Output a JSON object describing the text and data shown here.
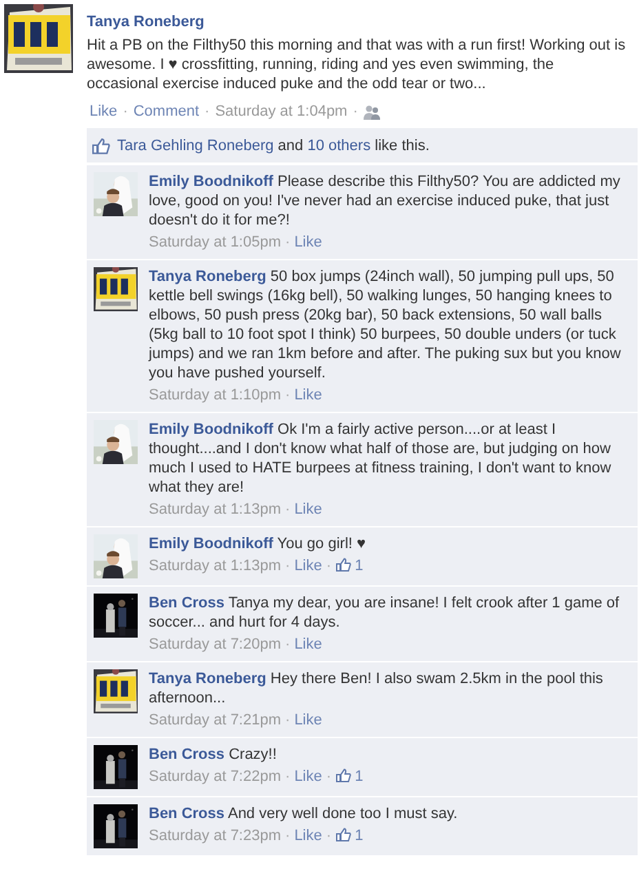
{
  "post": {
    "author": "Tanya Roneberg",
    "text": "Hit a PB on the Filthy50 this morning and that was with a run first! Working out is awesome. I ♥ crossfitting, running, riding and yes even swimming, the occasional exercise induced puke and the odd tear or two...",
    "actions": [
      "Like",
      "Comment"
    ],
    "time": "Saturday at 1:04pm",
    "separators": [
      "·",
      "·",
      "·"
    ]
  },
  "likes": {
    "name": "Tara Gehling Roneberg",
    "joiner": "and",
    "others": "10 others",
    "tail": "like this."
  },
  "comments": [
    {
      "author": "Emily Boodnikoff",
      "text": "Please describe this Filthy50? You are addicted my love, good on you! I've never had an exercise induced puke, that just doesn't do it for me?!",
      "time": "Saturday at 1:05pm",
      "separators": [
        "·"
      ],
      "like": "Like"
    },
    {
      "author": "Tanya Roneberg",
      "text": "50 box jumps (24inch wall), 50 jumping pull ups, 50 kettle bell swings (16kg bell), 50 walking lunges, 50 hanging knees to elbows, 50 push press (20kg bar), 50 back extensions, 50 wall balls (5kg ball to 10 foot spot I think) 50 burpees, 50 double unders (or tuck jumps) and we ran 1km before and after. The puking sux but you know you have pushed yourself.",
      "time": "Saturday at 1:10pm",
      "separators": [
        "·"
      ],
      "like": "Like"
    },
    {
      "author": "Emily Boodnikoff",
      "text": "Ok I'm a fairly active person....or at least I thought....and I don't know what half of those are, but judging on how much I used to HATE burpees at fitness training, I don't want to know what they are!",
      "time": "Saturday at 1:13pm",
      "separators": [
        "·"
      ],
      "like": "Like"
    },
    {
      "author": "Emily Boodnikoff",
      "text": "You go girl! ♥",
      "time": "Saturday at 1:13pm",
      "separators": [
        "·",
        "·"
      ],
      "like": "Like",
      "like_count": "1"
    },
    {
      "author": "Ben Cross",
      "text": "Tanya my dear, you are insane! I felt crook after 1 game of soccer... and hurt for 4 days.",
      "time": "Saturday at 7:20pm",
      "separators": [
        "·"
      ],
      "like": "Like"
    },
    {
      "author": "Tanya Roneberg",
      "text": "Hey there Ben! I also swam 2.5km in the pool this afternoon...",
      "time": "Saturday at 7:21pm",
      "separators": [
        "·"
      ],
      "like": "Like"
    },
    {
      "author": "Ben Cross",
      "text": "Crazy!!",
      "time": "Saturday at 7:22pm",
      "separators": [
        "·",
        "·"
      ],
      "like": "Like",
      "like_count": "1"
    },
    {
      "author": "Ben Cross",
      "text": "And very well done too I must say.",
      "time": "Saturday at 7:23pm",
      "separators": [
        "·",
        "·"
      ],
      "like": "Like",
      "like_count": "1"
    }
  ]
}
